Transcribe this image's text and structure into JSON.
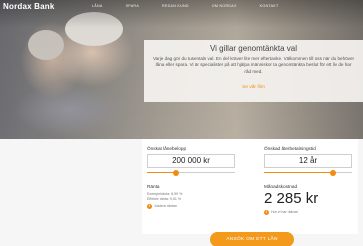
{
  "brand": {
    "name": "Nordax Bank"
  },
  "nav": {
    "items": [
      {
        "label": "LÅNA"
      },
      {
        "label": "SPARA"
      },
      {
        "label": "REDAN KUND"
      },
      {
        "label": "OM NORDAX"
      },
      {
        "label": "KONTAKT"
      }
    ]
  },
  "hero": {
    "title": "Vi gillar genomtänkta val",
    "body": "Varje dag gör du tusentals val. En del kräver lite mer eftertanke. Välkommen till oss när du behöver låna eller spara. Vi är specialister på att hjälpa människor ta genomtänkta beslut för ett liv de har råd med.",
    "link": "Se vår film"
  },
  "calculator": {
    "loan_amount_label": "Önskat lånebelopp",
    "loan_amount_value": "200 000 kr",
    "loan_amount_fraction": 0.33,
    "term_label": "Önskad återbetalningstid",
    "term_value": "12 år",
    "term_fraction": 0.78,
    "rate_label": "Ränta",
    "nominal_rate": "Exempelränta: 8,99 %",
    "effective_rate": "Effektiv ränta: 9,51 %",
    "rate_link": "Justera räntan",
    "monthly_label": "Månadskostnad",
    "monthly_value": "2 285 kr",
    "monthly_link": "Hur vi har räknat"
  },
  "cta": {
    "label": "ANSÖK OM ETT LÅN"
  },
  "colors": {
    "accent": "#f28c0f",
    "cta": "#f39a1d"
  },
  "icons": {
    "info": "info-icon"
  }
}
